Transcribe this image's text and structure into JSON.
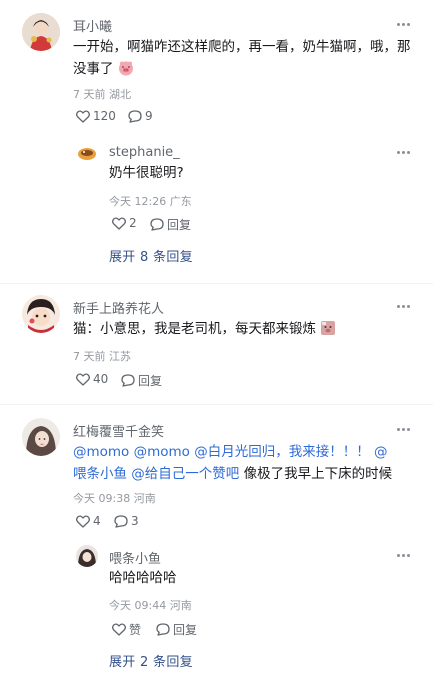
{
  "comments": [
    {
      "user": "耳小曦",
      "text_main": "一开始，啊猫咋还这样爬的，再一看，奶牛猫啊，哦，那没事了",
      "emoji": "pig-face-emoji",
      "time": "7 天前",
      "location": "湖北",
      "likes": "120",
      "replies": "9",
      "sub_reply": {
        "user": "stephanie_",
        "text": "奶牛很聪明?",
        "time": "今天 12:26",
        "location": "广东",
        "likes": "2",
        "reply_label": "回复"
      },
      "expand_label": "展开 8 条回复"
    },
    {
      "user": "新手上路养花人",
      "text": "猫：小意思，我是老司机，每天都来锻炼",
      "emoji": "pig-pink-sticker",
      "time": "7 天前",
      "location": "江苏",
      "likes": "40",
      "reply_label": "回复"
    },
    {
      "user": "红梅覆雪千金笑",
      "mention_1": "@momo @momo @白月光回归，我来接！！！ @",
      "text_line2_mention": "喂条小鱼",
      "mention_2": " @给自己一个赞吧",
      "text_tail": " 像极了我早上下床的时候",
      "time": "今天 09:38",
      "location": "河南",
      "likes": "4",
      "replies": "3",
      "sub_reply": {
        "user": "喂条小鱼",
        "text": "哈哈哈哈哈",
        "time": "今天 09:44",
        "location": "河南",
        "like_label": "赞",
        "reply_label": "回复"
      },
      "expand_label": "展开 2 条回复"
    }
  ],
  "colors": {
    "link_blue": "#2f6bd6",
    "expand_blue": "#35518a",
    "meta_gray": "#9499a0",
    "name_gray": "#61666d"
  }
}
